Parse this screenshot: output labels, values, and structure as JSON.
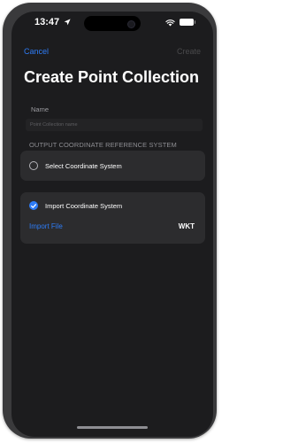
{
  "status_bar": {
    "time": "13:47"
  },
  "nav": {
    "cancel_label": "Cancel",
    "create_label": "Create"
  },
  "page": {
    "title": "Create Point Collection"
  },
  "form": {
    "name_label": "Name",
    "name_placeholder": "Point Collection name",
    "name_value": "",
    "crs_section_header": "OUTPUT COORDINATE REFERENCE SYSTEM",
    "options": [
      {
        "label": "Select Coordinate System",
        "selected": false
      },
      {
        "label": "Import Coordinate System",
        "selected": true
      }
    ],
    "import_file_label": "Import File",
    "format_label": "WKT"
  },
  "colors": {
    "accent": "#2e7cf6",
    "background": "#1c1c1e",
    "card": "#2c2c2e",
    "disabled": "#4a4a4c",
    "secondary_text": "#8e8e93"
  },
  "icons": {
    "location": "location-arrow-icon",
    "wifi": "wifi-icon",
    "battery": "battery-icon",
    "check": "checkmark-icon"
  }
}
